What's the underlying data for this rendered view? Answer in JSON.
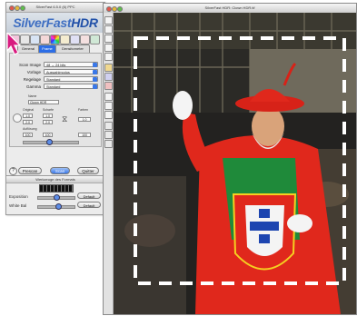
{
  "panel": {
    "window_title": "SilverFast 6.5.0 (6) PPC",
    "logo_main": "SilverFast",
    "logo_sub": "HDR",
    "tabs": [
      "General",
      "Frame",
      "Densitometer"
    ],
    "fields": [
      {
        "label": "Scan Image",
        "value": "48 → 24 bits"
      },
      {
        "label": "Vorlage",
        "value": "Auswahlmodus"
      },
      {
        "label": "Regelage",
        "value": "Standard"
      },
      {
        "label": "Gamma",
        "value": "Standard"
      }
    ],
    "name_label": "Name",
    "name_value": "Clown HDR",
    "size_headers": [
      "Original",
      "Scharfe",
      "Farben"
    ],
    "width_value": "1.0",
    "height_value": "2.0",
    "resolution_label": "Auflösung",
    "resolution_value": "100",
    "buttons": {
      "prescan": "Prescan",
      "scan": "Scan",
      "quit": "Quitter"
    },
    "tools_title": "Werkzeuge des Formats",
    "tools_rows": [
      {
        "label": "Exposition",
        "button": "Default"
      },
      {
        "label": "White Bal",
        "button": "Default"
      }
    ]
  },
  "preview": {
    "window_title": "SilverFast HDR: Clown HDR.tif",
    "selection_frame": "dashed"
  },
  "colors": {
    "accent": "#2d6ee6",
    "pointer": "#d81b7f",
    "costume_red": "#e0281c",
    "costume_green": "#1f8a3a"
  },
  "icons": [
    "mouse-pointer-arrow-icon",
    "scanner-icon",
    "gear-icon",
    "color-wheel-icon",
    "histogram-icon",
    "curve-icon"
  ]
}
